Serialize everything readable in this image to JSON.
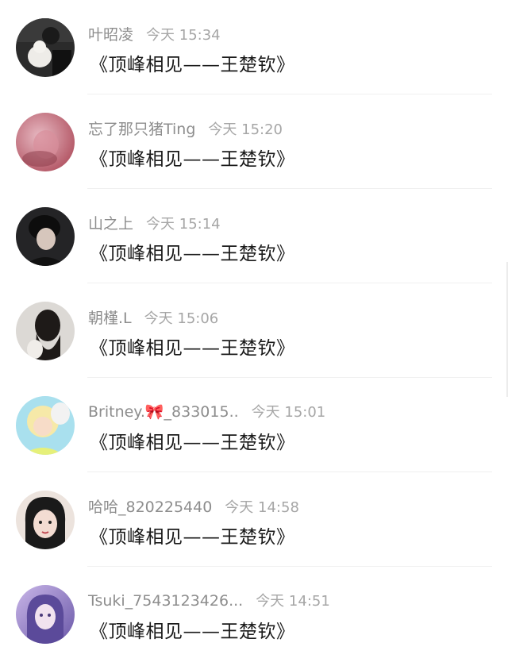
{
  "comments": [
    {
      "name": "叶昭凌",
      "time": "今天 15:34",
      "text": "《顶峰相见——王楚钦》",
      "avatar_colors": [
        "#2b2b2b",
        "#e8e6e2"
      ]
    },
    {
      "name": "忘了那只猪Ting",
      "time": "今天 15:20",
      "text": "《顶峰相见——王楚钦》",
      "avatar_colors": [
        "#c96b7b",
        "#e7b9c2"
      ]
    },
    {
      "name": "山之上",
      "time": "今天 15:14",
      "text": "《顶峰相见——王楚钦》",
      "avatar_colors": [
        "#1d1d1f",
        "#6a6a6e"
      ]
    },
    {
      "name": "朝槿.L",
      "time": "今天 15:06",
      "text": "《顶峰相见——王楚钦》",
      "avatar_colors": [
        "#d9d6d2",
        "#2a2420"
      ]
    },
    {
      "name": "Britney.🎀_833015..",
      "time": "今天 15:01",
      "text": "《顶峰相见——王楚钦》",
      "avatar_colors": [
        "#8fd6e8",
        "#f2e6a6"
      ]
    },
    {
      "name": "哈哈_820225440",
      "time": "今天 14:58",
      "text": "《顶峰相见——王楚钦》",
      "avatar_colors": [
        "#e9d6cf",
        "#1a1a1a"
      ]
    },
    {
      "name": "Tsuki_7543123426...",
      "time": "今天 14:51",
      "text": "《顶峰相见——王楚钦》",
      "avatar_colors": [
        "#7d6bb8",
        "#c9b6e8"
      ]
    }
  ]
}
